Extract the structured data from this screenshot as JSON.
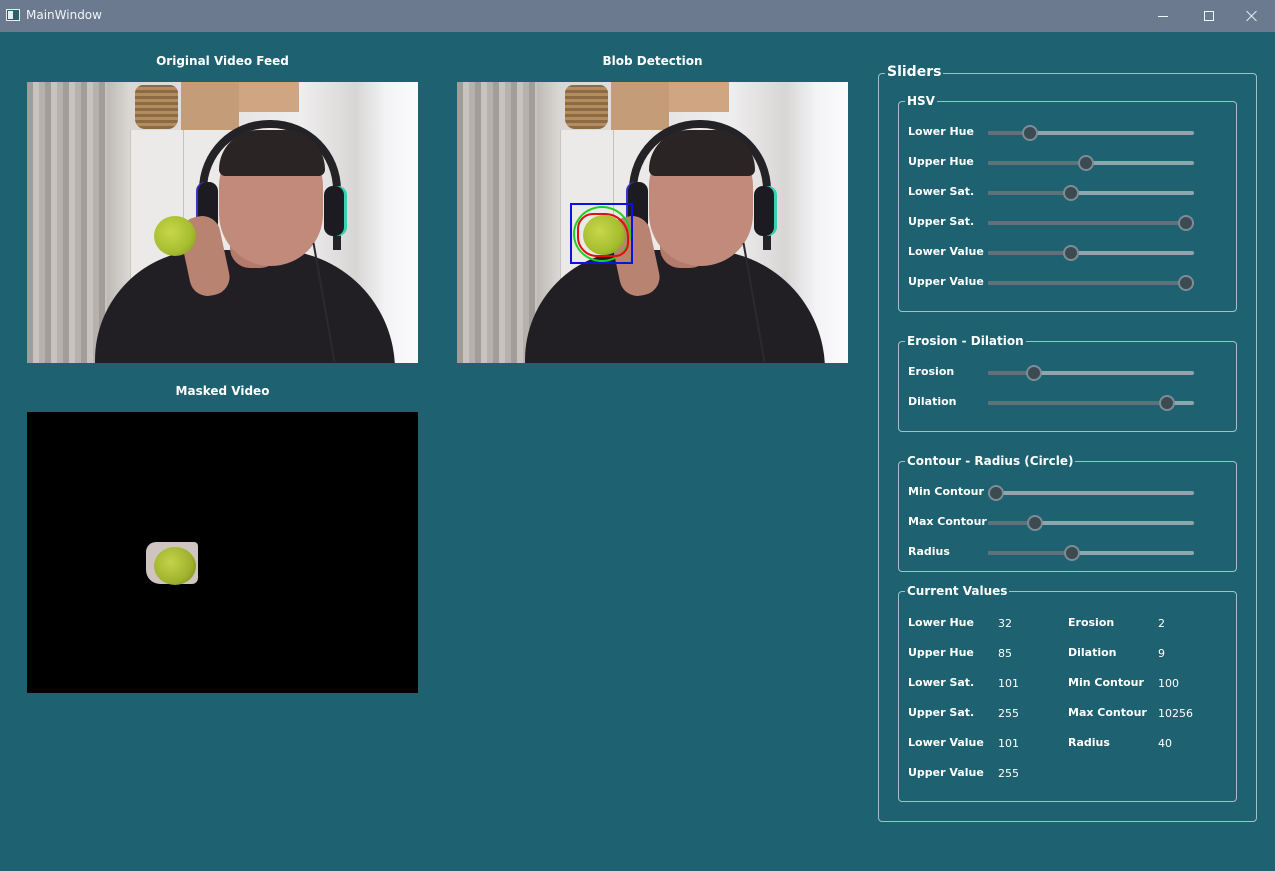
{
  "window": {
    "title": "MainWindow",
    "icon": "app-window-icon",
    "controls": [
      "minimize-icon",
      "maximize-icon",
      "close-icon"
    ]
  },
  "videos": {
    "original_label": "Original Video Feed",
    "blob_label": "Blob Detection",
    "masked_label": "Masked Video"
  },
  "sliders": {
    "title": "Sliders",
    "hsv": {
      "title": "HSV",
      "items": [
        {
          "label": "Lower Hue",
          "value": 32,
          "max": 179
        },
        {
          "label": "Upper Hue",
          "value": 85,
          "max": 179
        },
        {
          "label": "Lower Sat.",
          "value": 101,
          "max": 255
        },
        {
          "label": "Upper Sat.",
          "value": 255,
          "max": 255
        },
        {
          "label": "Lower Value",
          "value": 101,
          "max": 255
        },
        {
          "label": "Upper Value",
          "value": 255,
          "max": 255
        }
      ]
    },
    "erosion_dilation": {
      "title": "Erosion - Dilation",
      "items": [
        {
          "label": "Erosion",
          "value": 2,
          "max": 10
        },
        {
          "label": "Dilation",
          "value": 9,
          "max": 10
        }
      ]
    },
    "contour": {
      "title": "Contour - Radius (Circle)",
      "items": [
        {
          "label": "Min Contour",
          "value": 100,
          "max": 50000
        },
        {
          "label": "Max Contour",
          "value": 10256,
          "max": 50000
        },
        {
          "label": "Radius",
          "value": 40,
          "max": 100
        }
      ]
    }
  },
  "current_values": {
    "title": "Current Values",
    "left": [
      {
        "label": "Lower Hue",
        "value": "32"
      },
      {
        "label": "Upper Hue",
        "value": "85"
      },
      {
        "label": "Lower Sat.",
        "value": "101"
      },
      {
        "label": "Upper Sat.",
        "value": "255"
      },
      {
        "label": "Lower Value",
        "value": "101"
      },
      {
        "label": "Upper Value",
        "value": "255"
      }
    ],
    "right": [
      {
        "label": "Erosion",
        "value": "2"
      },
      {
        "label": "Dilation",
        "value": "9"
      },
      {
        "label": "Min Contour",
        "value": "100"
      },
      {
        "label": "Max Contour",
        "value": "10256"
      },
      {
        "label": "Radius",
        "value": "40"
      }
    ]
  },
  "colors": {
    "background": "#1e6170",
    "titlebar": "#6b7a8e",
    "bbox": "#0a14e0",
    "circle": "#20d020",
    "contour": "#e01010"
  }
}
